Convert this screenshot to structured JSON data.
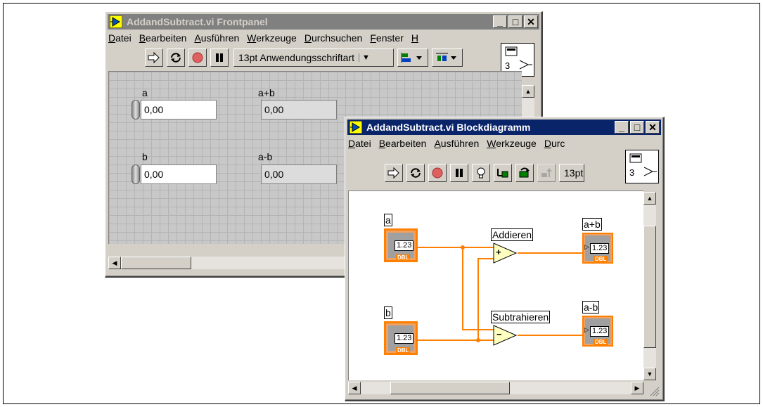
{
  "frontpanel": {
    "title": "AddandSubtract.vi Frontpanel",
    "menu": [
      "Datei",
      "Bearbeiten",
      "Ausführen",
      "Werkzeuge",
      "Durchsuchen",
      "Fenster",
      "H"
    ],
    "font_selector": "13pt Anwendungsschriftart",
    "connector_number": "3",
    "controls": [
      {
        "label": "a",
        "value": "0,00"
      },
      {
        "label": "b",
        "value": "0,00"
      }
    ],
    "indicators": [
      {
        "label": "a+b",
        "value": "0,00"
      },
      {
        "label": "a-b",
        "value": "0,00"
      }
    ]
  },
  "blockdiagram": {
    "title": "AddandSubtract.vi Blockdiagramm",
    "menu": [
      "Datei",
      "Bearbeiten",
      "Ausführen",
      "Werkzeuge",
      "Durc"
    ],
    "font_selector": "13pt",
    "connector_number": "3",
    "terminals": {
      "a": "a",
      "b": "b",
      "sum": "a+b",
      "diff": "a-b",
      "value_text": "1.23",
      "type_text": "DBL"
    },
    "nodes": {
      "add": {
        "label": "Addieren",
        "symbol": "+"
      },
      "subtract": {
        "label": "Subtrahieren",
        "symbol": "−"
      }
    }
  },
  "colors": {
    "wire": "#ff7f00",
    "active_title": "#0a246a",
    "inactive_title": "#808080"
  }
}
